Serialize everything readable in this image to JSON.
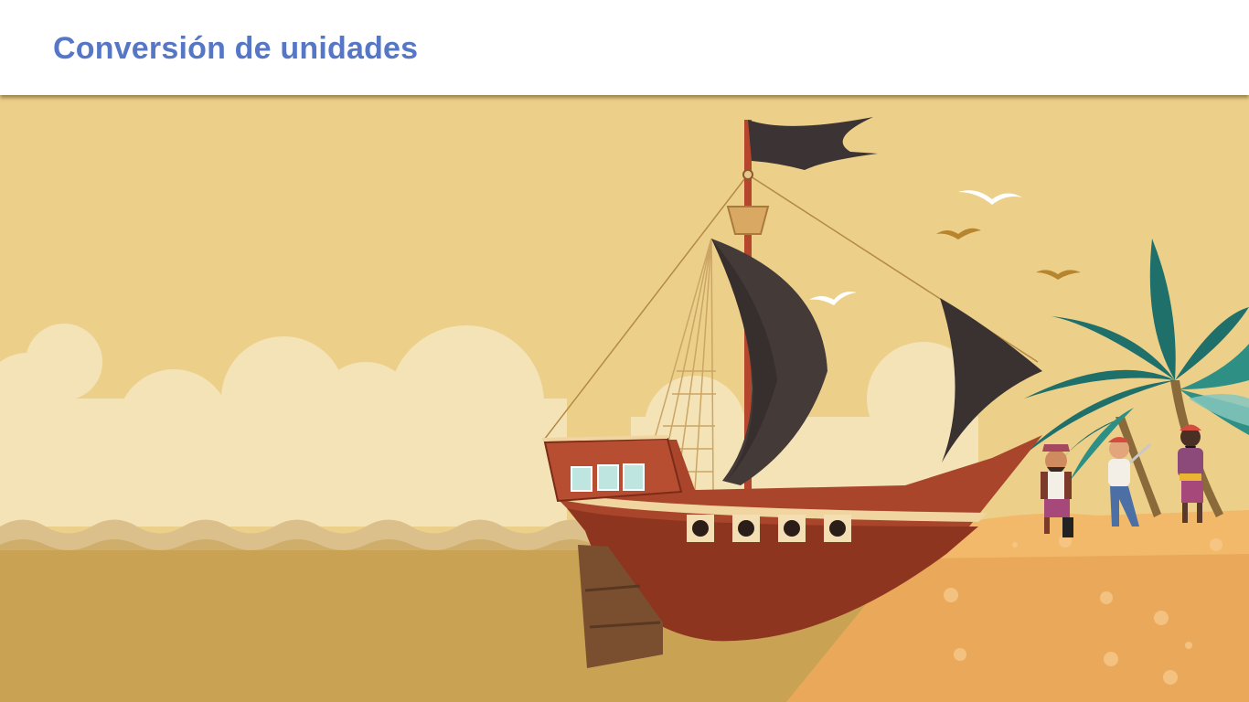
{
  "header": {
    "title": "Conversión de unidades"
  },
  "scene": {
    "description_icon": "pirate-ship-illustration",
    "colors": {
      "title": "#5577c6",
      "sky": "#ecd08a",
      "sea": "#c9a253",
      "sand": "#eaa95a",
      "hull": "#a9452b",
      "sail": "#443a38"
    }
  }
}
